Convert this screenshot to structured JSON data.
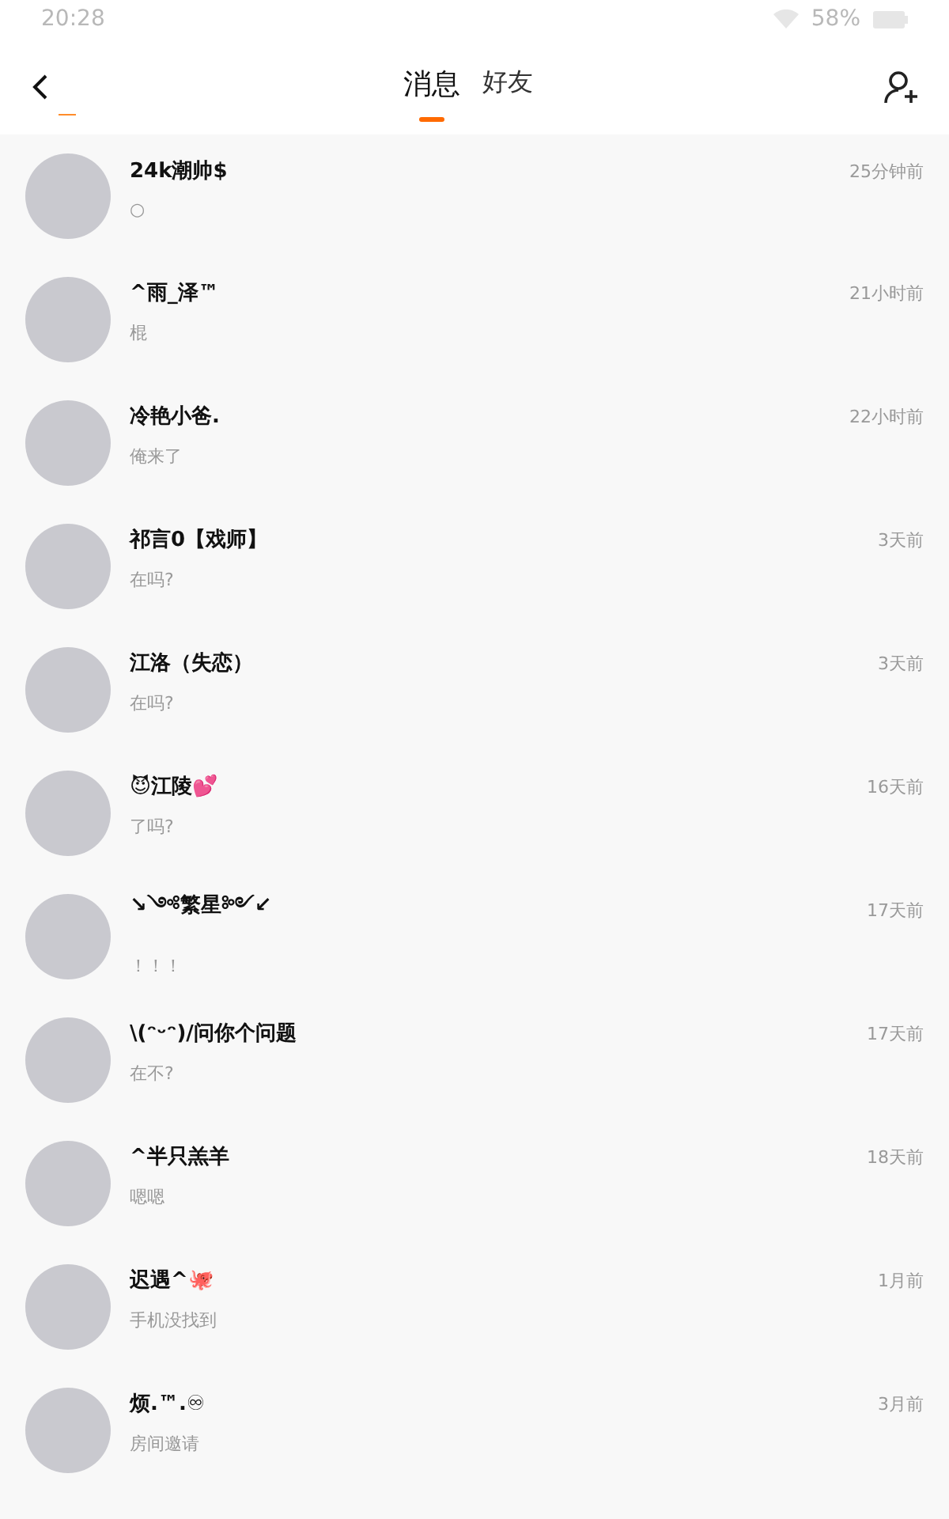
{
  "status_bar": {
    "time": "20:28",
    "battery": "58%"
  },
  "tabs": [
    {
      "label": "消息",
      "selected": true
    },
    {
      "label": "好友",
      "selected": false
    }
  ],
  "conversations": [
    {
      "name": "24k潮帅$",
      "preview": "○",
      "time": "25分钟前"
    },
    {
      "name": "^雨_泽™",
      "preview": "棍",
      "time": "21小时前"
    },
    {
      "name": "冷艳小爸.",
      "preview": "俺来了",
      "time": "22小时前"
    },
    {
      "name": "祁言0【戏师】",
      "preview": "在吗?",
      "time": "3天前"
    },
    {
      "name": "江洛（失恋）",
      "preview": "在吗?",
      "time": "3天前"
    },
    {
      "name": "😈江陵💕",
      "preview": "了吗?",
      "time": "16天前"
    },
    {
      "name": "↘༺繁星༻↙",
      "preview": "！！！",
      "time": "17天前"
    },
    {
      "name": "\\(ᵔᵕᵔ)/问你个问题",
      "preview": "在不?",
      "time": "17天前"
    },
    {
      "name": "^半只羔羊",
      "preview": "嗯嗯",
      "time": "18天前"
    },
    {
      "name": "迟遇^🐙",
      "preview": "手机没找到",
      "time": "1月前"
    },
    {
      "name": "烦.™.♾",
      "preview": "房间邀请",
      "time": "3月前"
    }
  ]
}
